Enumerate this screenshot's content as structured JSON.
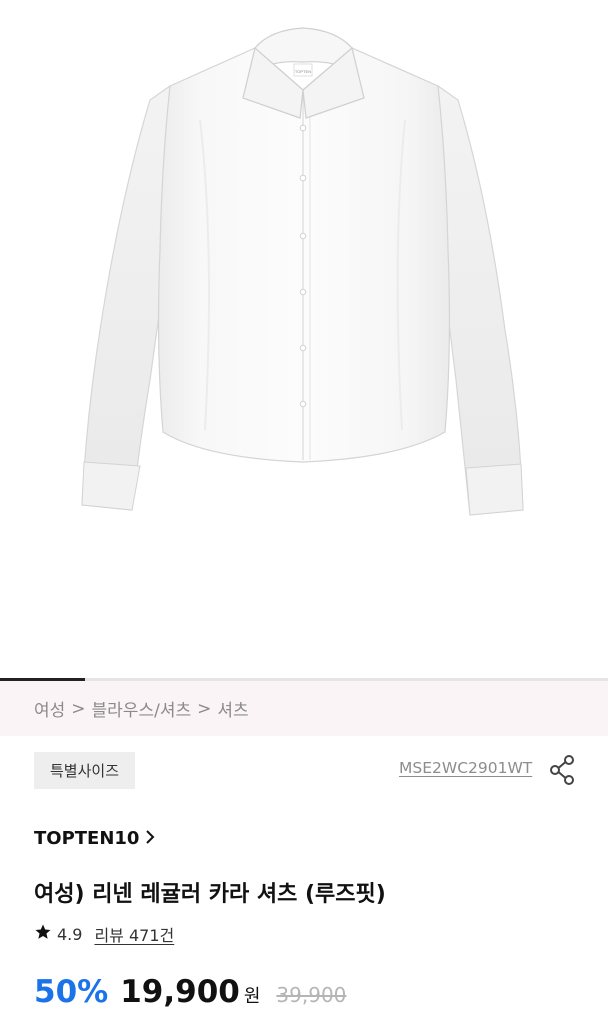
{
  "product_image": {
    "label_on_collar": "TOPTEN"
  },
  "pager": {
    "current_fraction": 0.14
  },
  "breadcrumb": [
    "여성",
    "블라우스/셔츠",
    "셔츠"
  ],
  "breadcrumb_separator": ">",
  "tag": "특별사이즈",
  "product_code": "MSE2WC2901WT",
  "brand": "TOPTEN10",
  "title": "여성) 리넨 레귤러 카라 셔츠 (루즈핏)",
  "rating": {
    "score": "4.9",
    "reviews_label": "리뷰 471건"
  },
  "price": {
    "discount": "50%",
    "sale": "19,900",
    "currency": "원",
    "original": "39,900"
  },
  "icons": {
    "share": "share-icon",
    "star": "star-icon",
    "chevron": "chevron-right-icon"
  },
  "colors": {
    "discount": "#1a73e8",
    "breadcrumb_bg": "#fbf4f7",
    "tag_bg": "#eeeeee"
  }
}
